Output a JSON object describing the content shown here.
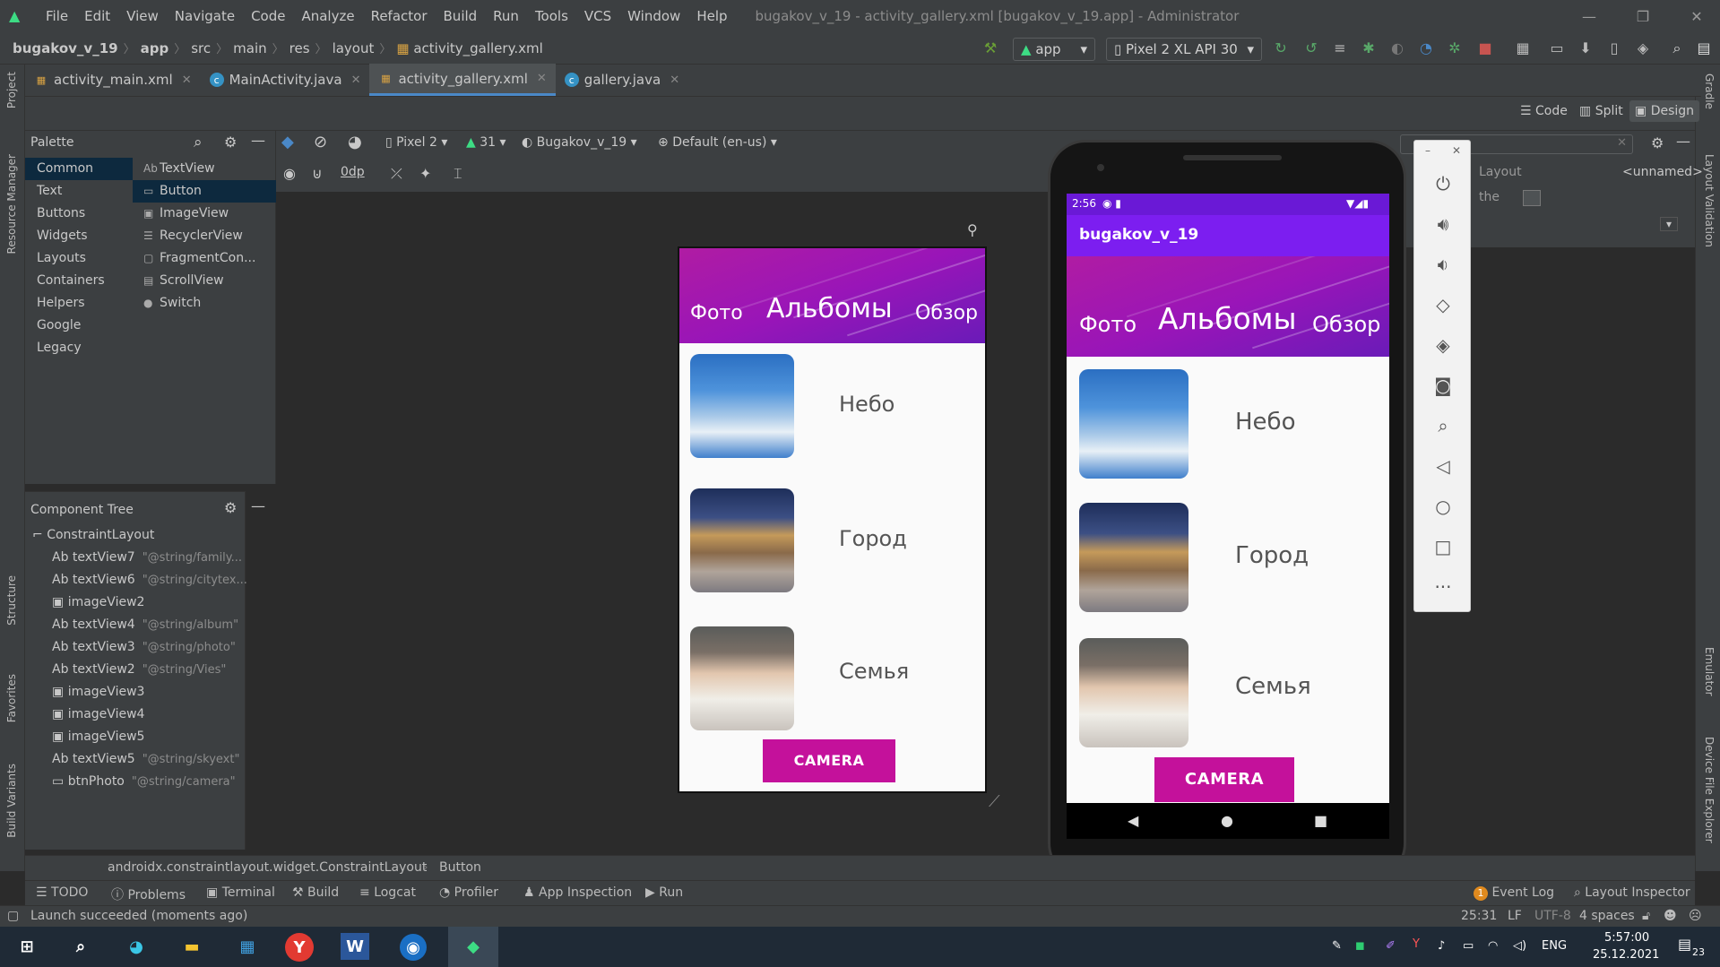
{
  "window": {
    "title": "bugakov_v_19 - activity_gallery.xml [bugakov_v_19.app] - Administrator",
    "menu": [
      "File",
      "Edit",
      "View",
      "Navigate",
      "Code",
      "Analyze",
      "Refactor",
      "Build",
      "Run",
      "Tools",
      "VCS",
      "Window",
      "Help"
    ]
  },
  "breadcrumbs": [
    "bugakov_v_19",
    "app",
    "src",
    "main",
    "res",
    "layout",
    "activity_gallery.xml"
  ],
  "run_config": "app",
  "device": "Pixel 2 XL API 30",
  "tabs": [
    {
      "label": "activity_main.xml",
      "icon": "xml-icon"
    },
    {
      "label": "MainActivity.java",
      "icon": "class-icon"
    },
    {
      "label": "activity_gallery.xml",
      "icon": "xml-icon",
      "active": true
    },
    {
      "label": "gallery.java",
      "icon": "class-icon"
    }
  ],
  "view_modes": [
    "Code",
    "Split",
    "Design"
  ],
  "side_left": [
    "Project",
    "Resource Manager",
    "Structure",
    "Favorites",
    "Build Variants"
  ],
  "side_right": [
    "Gradle",
    "Layout Validation",
    "Emulator",
    "Device File Explorer"
  ],
  "palette": {
    "title": "Palette",
    "categories": [
      "Common",
      "Text",
      "Buttons",
      "Widgets",
      "Layouts",
      "Containers",
      "Helpers",
      "Google",
      "Legacy"
    ],
    "items": [
      {
        "icon": "Ab",
        "label": "TextView"
      },
      {
        "icon": "▭",
        "label": "Button"
      },
      {
        "icon": "▣",
        "label": "ImageView"
      },
      {
        "icon": "☰",
        "label": "RecyclerView"
      },
      {
        "icon": "▢",
        "label": "FragmentCon..."
      },
      {
        "icon": "▤",
        "label": "ScrollView"
      },
      {
        "icon": "●",
        "label": "Switch"
      }
    ]
  },
  "design_toolbar": {
    "device": "Pixel 2",
    "api": "31",
    "theme": "Bugakov_v_19",
    "locale": "Default (en-us)",
    "margin": "0dp"
  },
  "component_tree": {
    "title": "Component Tree",
    "root": "ConstraintLayout",
    "nodes": [
      {
        "type": "Ab",
        "name": "textView7",
        "hint": "\"@string/family..."
      },
      {
        "type": "Ab",
        "name": "textView6",
        "hint": "\"@string/citytex..."
      },
      {
        "type": "img",
        "name": "imageView2",
        "hint": ""
      },
      {
        "type": "Ab",
        "name": "textView4",
        "hint": "\"@string/album\""
      },
      {
        "type": "Ab",
        "name": "textView3",
        "hint": "\"@string/photo\""
      },
      {
        "type": "Ab",
        "name": "textView2",
        "hint": "\"@string/Vies\""
      },
      {
        "type": "img",
        "name": "imageView3",
        "hint": ""
      },
      {
        "type": "img",
        "name": "imageView4",
        "hint": ""
      },
      {
        "type": "img",
        "name": "imageView5",
        "hint": ""
      },
      {
        "type": "Ab",
        "name": "textView5",
        "hint": "\"@string/skyext\""
      },
      {
        "type": "btn",
        "name": "btnPhoto",
        "hint": "\"@string/camera\""
      }
    ]
  },
  "app_ui": {
    "header": {
      "photo": "Фото",
      "albums": "Альбомы",
      "overview": "Обзор"
    },
    "rows": [
      "Небо",
      "Город",
      "Семья"
    ],
    "button": "CAMERA"
  },
  "emulator": {
    "time": "2:56",
    "app_title": "bugakov_v_19"
  },
  "attributes": {
    "layout": "Layout",
    "unnamed": "<unnamed>",
    "the": "the"
  },
  "selection_path": [
    "androidx.constraintlayout.widget.ConstraintLayout",
    "Button"
  ],
  "tool_windows": [
    "TODO",
    "Problems",
    "Terminal",
    "Build",
    "Logcat",
    "Profiler",
    "App Inspection",
    "Run"
  ],
  "tool_windows_right": [
    "Event Log",
    "Layout Inspector"
  ],
  "event_count": "1",
  "status": {
    "message": "Launch succeeded (moments ago)",
    "position": "25:31",
    "line_sep": "LF",
    "encoding": "UTF-8",
    "indent": "4 spaces"
  },
  "taskbar": {
    "lang": "ENG",
    "time": "5:57:00",
    "date": "25.12.2021",
    "notifications": "23"
  },
  "colors": {
    "accent": "#4a88c7",
    "app_purple": "#9b17b5",
    "button": "#c4119b",
    "appbar": "#7c1ef0"
  }
}
